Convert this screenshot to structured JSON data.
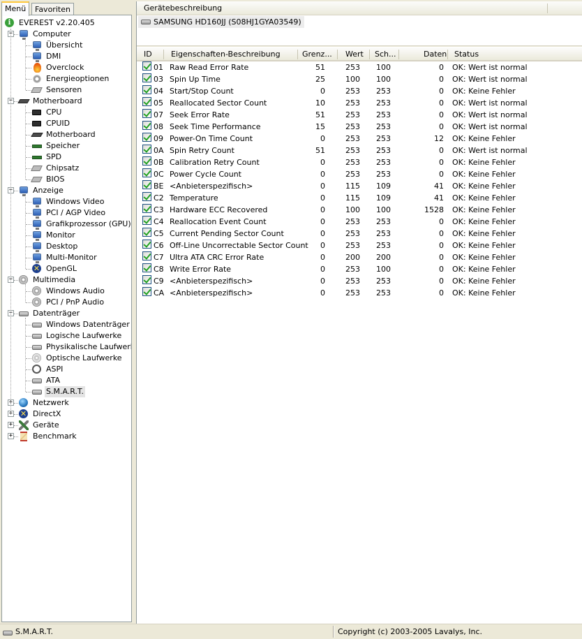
{
  "tabs": [
    "Menü",
    "Favoriten"
  ],
  "tree": [
    {
      "label": "EVEREST v2.20.405",
      "icon": "info-icon",
      "cls": "i-info",
      "level": 0,
      "expander": ""
    },
    {
      "label": "Computer",
      "icon": "computer-icon",
      "cls": "i-monitor",
      "level": 1,
      "expander": "-"
    },
    {
      "label": "Übersicht",
      "icon": "monitor-icon",
      "cls": "i-monitor",
      "level": 2,
      "expander": ""
    },
    {
      "label": "DMI",
      "icon": "monitor-icon",
      "cls": "i-monitor",
      "level": 2,
      "expander": ""
    },
    {
      "label": "Overclock",
      "icon": "fire-icon",
      "cls": "i-fire",
      "level": 2,
      "expander": ""
    },
    {
      "label": "Energieoptionen",
      "icon": "power-icon",
      "cls": "i-gear",
      "level": 2,
      "expander": ""
    },
    {
      "label": "Sensoren",
      "icon": "sensor-icon",
      "cls": "i-gray",
      "level": 2,
      "expander": ""
    },
    {
      "label": "Motherboard",
      "icon": "motherboard-icon",
      "cls": "i-board",
      "level": 1,
      "expander": "-"
    },
    {
      "label": "CPU",
      "icon": "cpu-icon",
      "cls": "i-chip",
      "level": 2,
      "expander": ""
    },
    {
      "label": "CPUID",
      "icon": "cpu-icon",
      "cls": "i-chip",
      "level": 2,
      "expander": ""
    },
    {
      "label": "Motherboard",
      "icon": "motherboard-icon",
      "cls": "i-board",
      "level": 2,
      "expander": ""
    },
    {
      "label": "Speicher",
      "icon": "memory-icon",
      "cls": "i-mem",
      "level": 2,
      "expander": ""
    },
    {
      "label": "SPD",
      "icon": "memory-icon",
      "cls": "i-mem",
      "level": 2,
      "expander": ""
    },
    {
      "label": "Chipsatz",
      "icon": "chipset-icon",
      "cls": "i-gray",
      "level": 2,
      "expander": ""
    },
    {
      "label": "BIOS",
      "icon": "bios-icon",
      "cls": "i-gray",
      "level": 2,
      "expander": ""
    },
    {
      "label": "Anzeige",
      "icon": "display-icon",
      "cls": "i-monitor",
      "level": 1,
      "expander": "-"
    },
    {
      "label": "Windows Video",
      "icon": "monitor-icon",
      "cls": "i-monitor",
      "level": 2,
      "expander": ""
    },
    {
      "label": "PCI / AGP Video",
      "icon": "monitor-icon",
      "cls": "i-monitor",
      "level": 2,
      "expander": ""
    },
    {
      "label": "Grafikprozessor (GPU)",
      "icon": "monitor-icon",
      "cls": "i-monitor",
      "level": 2,
      "expander": ""
    },
    {
      "label": "Monitor",
      "icon": "monitor-icon",
      "cls": "i-monitor",
      "level": 2,
      "expander": ""
    },
    {
      "label": "Desktop",
      "icon": "desktop-icon",
      "cls": "i-monitor",
      "level": 2,
      "expander": ""
    },
    {
      "label": "Multi-Monitor",
      "icon": "monitor-icon",
      "cls": "i-monitor",
      "level": 2,
      "expander": ""
    },
    {
      "label": "OpenGL",
      "icon": "opengl-icon",
      "cls": "i-x",
      "level": 2,
      "expander": ""
    },
    {
      "label": "Multimedia",
      "icon": "speaker-icon",
      "cls": "i-speaker",
      "level": 1,
      "expander": "-"
    },
    {
      "label": "Windows Audio",
      "icon": "speaker-icon",
      "cls": "i-speaker",
      "level": 2,
      "expander": ""
    },
    {
      "label": "PCI / PnP Audio",
      "icon": "speaker-icon",
      "cls": "i-speaker",
      "level": 2,
      "expander": ""
    },
    {
      "label": "Datenträger",
      "icon": "drive-icon",
      "cls": "i-disk",
      "level": 1,
      "expander": "-"
    },
    {
      "label": "Windows Datenträger",
      "icon": "drive-icon",
      "cls": "i-disk",
      "level": 2,
      "expander": ""
    },
    {
      "label": "Logische Laufwerke",
      "icon": "logical-drive-icon",
      "cls": "i-disk",
      "level": 2,
      "expander": ""
    },
    {
      "label": "Physikalische Laufwerke",
      "icon": "drive-icon",
      "cls": "i-disk",
      "level": 2,
      "expander": ""
    },
    {
      "label": "Optische Laufwerke",
      "icon": "cd-icon",
      "cls": "i-cd",
      "level": 2,
      "expander": ""
    },
    {
      "label": "ASPI",
      "icon": "aspi-icon",
      "cls": "i-aspi",
      "level": 2,
      "expander": ""
    },
    {
      "label": "ATA",
      "icon": "drive-icon",
      "cls": "i-disk",
      "level": 2,
      "expander": ""
    },
    {
      "label": "S.M.A.R.T.",
      "icon": "drive-icon",
      "cls": "i-disk",
      "level": 2,
      "expander": "",
      "selected": true
    },
    {
      "label": "Netzwerk",
      "icon": "network-icon",
      "cls": "i-globe",
      "level": 1,
      "expander": "+"
    },
    {
      "label": "DirectX",
      "icon": "directx-icon",
      "cls": "i-x",
      "level": 1,
      "expander": "+"
    },
    {
      "label": "Geräte",
      "icon": "devices-icon",
      "cls": "i-tools",
      "level": 1,
      "expander": "+"
    },
    {
      "label": "Benchmark",
      "icon": "hourglass-icon",
      "cls": "i-hour",
      "level": 1,
      "expander": "+"
    }
  ],
  "device_header": "Gerätebeschreibung",
  "device_name": "SAMSUNG HD160JJ (S08HJ1GYA03549)",
  "columns": [
    "ID",
    "Eigenschaften-Beschreibung",
    "Grenz...",
    "Wert",
    "Sch...",
    "Daten",
    "Status"
  ],
  "rows": [
    {
      "id": "01",
      "desc": "Raw Read Error Rate",
      "thr": "51",
      "val": "253",
      "worst": "100",
      "data": "0",
      "status": "OK: Wert ist normal"
    },
    {
      "id": "03",
      "desc": "Spin Up Time",
      "thr": "25",
      "val": "100",
      "worst": "100",
      "data": "0",
      "status": "OK: Wert ist normal"
    },
    {
      "id": "04",
      "desc": "Start/Stop Count",
      "thr": "0",
      "val": "253",
      "worst": "253",
      "data": "0",
      "status": "OK: Keine Fehler"
    },
    {
      "id": "05",
      "desc": "Reallocated Sector Count",
      "thr": "10",
      "val": "253",
      "worst": "253",
      "data": "0",
      "status": "OK: Wert ist normal"
    },
    {
      "id": "07",
      "desc": "Seek Error Rate",
      "thr": "51",
      "val": "253",
      "worst": "253",
      "data": "0",
      "status": "OK: Wert ist normal"
    },
    {
      "id": "08",
      "desc": "Seek Time Performance",
      "thr": "15",
      "val": "253",
      "worst": "253",
      "data": "0",
      "status": "OK: Wert ist normal"
    },
    {
      "id": "09",
      "desc": "Power-On Time Count",
      "thr": "0",
      "val": "253",
      "worst": "253",
      "data": "12",
      "status": "OK: Keine Fehler"
    },
    {
      "id": "0A",
      "desc": "Spin Retry Count",
      "thr": "51",
      "val": "253",
      "worst": "253",
      "data": "0",
      "status": "OK: Wert ist normal"
    },
    {
      "id": "0B",
      "desc": "Calibration Retry Count",
      "thr": "0",
      "val": "253",
      "worst": "253",
      "data": "0",
      "status": "OK: Keine Fehler"
    },
    {
      "id": "0C",
      "desc": "Power Cycle Count",
      "thr": "0",
      "val": "253",
      "worst": "253",
      "data": "0",
      "status": "OK: Keine Fehler"
    },
    {
      "id": "BE",
      "desc": "<Anbieterspezifisch>",
      "thr": "0",
      "val": "115",
      "worst": "109",
      "data": "41",
      "status": "OK: Keine Fehler"
    },
    {
      "id": "C2",
      "desc": "Temperature",
      "thr": "0",
      "val": "115",
      "worst": "109",
      "data": "41",
      "status": "OK: Keine Fehler"
    },
    {
      "id": "C3",
      "desc": "Hardware ECC Recovered",
      "thr": "0",
      "val": "100",
      "worst": "100",
      "data": "1528",
      "status": "OK: Keine Fehler"
    },
    {
      "id": "C4",
      "desc": "Reallocation Event Count",
      "thr": "0",
      "val": "253",
      "worst": "253",
      "data": "0",
      "status": "OK: Keine Fehler"
    },
    {
      "id": "C5",
      "desc": "Current Pending Sector Count",
      "thr": "0",
      "val": "253",
      "worst": "253",
      "data": "0",
      "status": "OK: Keine Fehler"
    },
    {
      "id": "C6",
      "desc": "Off-Line Uncorrectable Sector Count",
      "thr": "0",
      "val": "253",
      "worst": "253",
      "data": "0",
      "status": "OK: Keine Fehler"
    },
    {
      "id": "C7",
      "desc": "Ultra ATA CRC Error Rate",
      "thr": "0",
      "val": "200",
      "worst": "200",
      "data": "0",
      "status": "OK: Keine Fehler"
    },
    {
      "id": "C8",
      "desc": "Write Error Rate",
      "thr": "0",
      "val": "253",
      "worst": "100",
      "data": "0",
      "status": "OK: Keine Fehler"
    },
    {
      "id": "C9",
      "desc": "<Anbieterspezifisch>",
      "thr": "0",
      "val": "253",
      "worst": "253",
      "data": "0",
      "status": "OK: Keine Fehler"
    },
    {
      "id": "CA",
      "desc": "<Anbieterspezifisch>",
      "thr": "0",
      "val": "253",
      "worst": "253",
      "data": "0",
      "status": "OK: Keine Fehler"
    }
  ],
  "statusbar": {
    "left": "S.M.A.R.T.",
    "right": "Copyright (c) 2003-2005 Lavalys, Inc."
  },
  "colors": {
    "check": "#21a121",
    "selection": "#e4e4e4"
  }
}
